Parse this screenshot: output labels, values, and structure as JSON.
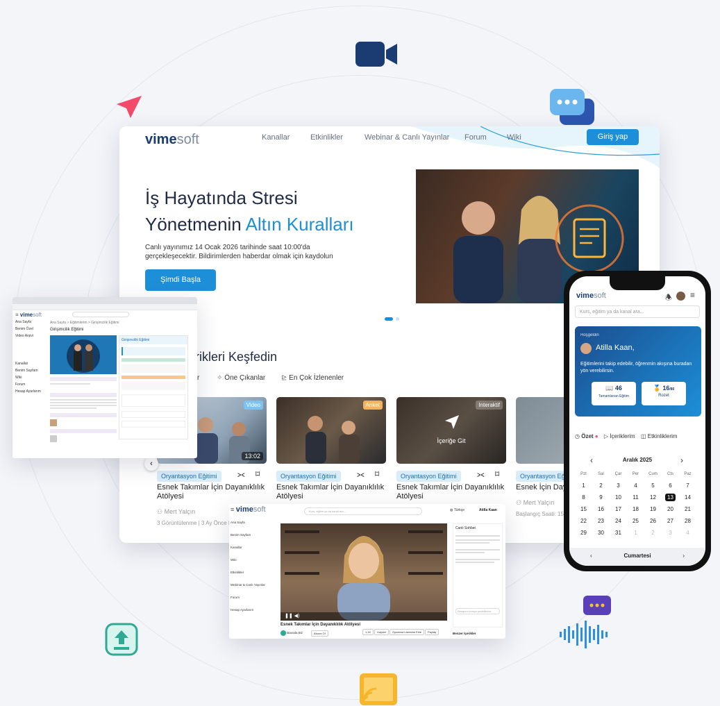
{
  "colors": {
    "accent": "#1d8fd8",
    "navy": "#1a3c72",
    "bg": "#f3f5f9",
    "badge_video": "#7cc3ef",
    "badge_event": "#f2b45e"
  },
  "website": {
    "logo_bold": "vime",
    "logo_light": "soft",
    "nav": [
      "Kanallar",
      "Etkinlikler",
      "Webinar & Canlı Yayınlar",
      "Forum",
      "Wiki"
    ],
    "login": "Giriş yap",
    "hero": {
      "title_line1": "İş Hayatında Stresi",
      "title_line2a": "Yönetmenin ",
      "title_line2b": "Altın Kuralları",
      "desc": "Canlı yayınımız 14 Ocak 2026 tarihinde saat 10:00'da gerçekleşecektir. Bildirimlerden haberdar olmak için kaydolun",
      "cta": "Şimdi Başla"
    },
    "discover_title": "rikleri Keşfedin",
    "tabs": [
      "r",
      "Öne Çıkanlar",
      "En Çok İzlenenler"
    ],
    "cards": [
      {
        "badge": "Video",
        "duration": "13:02",
        "category": "Oryantasyon Eğitimi",
        "title": "Esnek Takımlar İçin Dayanıklılık Atölyesi",
        "author": "Mert Yalçın",
        "meta": "3 Görüntülenme | 3 Ay Önce Ek"
      },
      {
        "badge": "Anket",
        "category": "Oryantasyon Eğitimi",
        "title": "Esnek Takımlar İçin Dayanıklılık Atölyesi"
      },
      {
        "badge": "Interaktif",
        "overlay": "İçeriğe Git",
        "category": "Oryantasyon Eğitimi",
        "title": "Esnek Takımlar İçin Dayanıklılık Atölyesi"
      },
      {
        "category": "Oryantasyon Eğitimi",
        "title": "Esnek İçin Day",
        "author": "Mert Yalçın",
        "meta": "Başlangıç Saati: 15 K"
      }
    ]
  },
  "admin": {
    "sidebar": [
      "Ana Sayfa",
      "Benim Özel",
      "Video Arşivi",
      "Kanallar",
      "Benim Sayfam",
      "Wiki",
      "Forum",
      "Hesap Ayarlarım"
    ],
    "breadcrumb": "Ana Sayfa > Eğitimlerim > Girişimcilik Eğitimi",
    "page_title": "Girişimcilik Eğitimi",
    "panel_title": "Girişimcilik Eğitimi"
  },
  "player": {
    "sidebar": [
      "Ana Sayfa",
      "Benim Sayfam",
      "Kanallar",
      "Wiki",
      "Etkinlikler",
      "Webinar & Canlı Yayınlar",
      "Forum",
      "Hesap Ayarlarım"
    ],
    "search_placeholder": "Kurs, eğitim ya da kanal ara...",
    "lang": "Türkçe",
    "user": "Atilla Kaan",
    "chat_title": "Canlı Sohbet",
    "chat_input": "Mesajınızı buraya yazabilirsiniz",
    "video_title": "Esnek Takımlar İçin Dayanıklılık Atölyesi",
    "channel": "Bavoda Biz",
    "follow": "Abone Ol",
    "actions": [
      "1,1K",
      "Kaydet",
      "Oynatma Listesine Ekle",
      "Paylaş"
    ],
    "similar": "Benzer İçerikler"
  },
  "phone": {
    "search": "Kurs, eğitim ya da kanal ara...",
    "greeting": "Hoşgeldin",
    "user": "Atilla Kaan,",
    "subtitle": "Eğitimlerini takip edebilir, öğrenmin akışına buradan yön verebilirsin.",
    "stat1_value": "46",
    "stat1_label": "Tamamlanan Eğitim",
    "stat2_value": "16",
    "stat2_suffix": "/80",
    "stat2_label": "Rozet",
    "tabs": [
      "Özet",
      "İçeriklerim",
      "Etkinliklerim"
    ],
    "month": "Aralık 2025",
    "weekdays": [
      "Pzt",
      "Sal",
      "Çar",
      "Per",
      "Cum",
      "Cts",
      "Paz"
    ],
    "weeks": [
      [
        "1",
        "2",
        "3",
        "4",
        "5",
        "6",
        "7"
      ],
      [
        "8",
        "9",
        "10",
        "11",
        "12",
        "13",
        "14"
      ],
      [
        "15",
        "16",
        "17",
        "18",
        "19",
        "20",
        "21"
      ],
      [
        "22",
        "23",
        "24",
        "25",
        "26",
        "27",
        "28"
      ],
      [
        "29",
        "30",
        "31",
        "1",
        "2",
        "3",
        "4"
      ]
    ],
    "selected_day": "Cumartesi"
  }
}
